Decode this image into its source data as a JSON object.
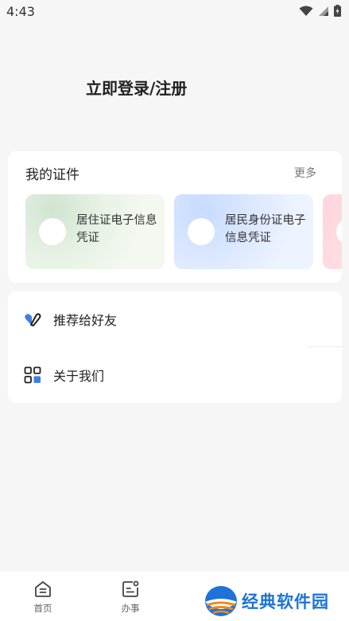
{
  "status_bar": {
    "time": "4:43"
  },
  "header": {
    "login_label": "立即登录/注册"
  },
  "certificates": {
    "title": "我的证件",
    "more_label": "更多",
    "items": [
      {
        "name": "居住证电子信息凭证"
      },
      {
        "name": "居民身份证电子信息凭证"
      },
      {
        "name": ""
      }
    ]
  },
  "menu": {
    "items": [
      {
        "label": "推荐给好友",
        "icon": "heart-share-icon"
      },
      {
        "label": "关于我们",
        "icon": "apps-grid-icon"
      }
    ]
  },
  "bottom_nav": {
    "items": [
      {
        "label": "首页",
        "icon": "home-icon"
      },
      {
        "label": "办事",
        "icon": "tasks-icon"
      }
    ]
  },
  "watermark": {
    "text": "经典软件园"
  },
  "colors": {
    "background": "#f5f6f5",
    "card": "#ffffff",
    "accent_blue": "#1e73d9"
  }
}
